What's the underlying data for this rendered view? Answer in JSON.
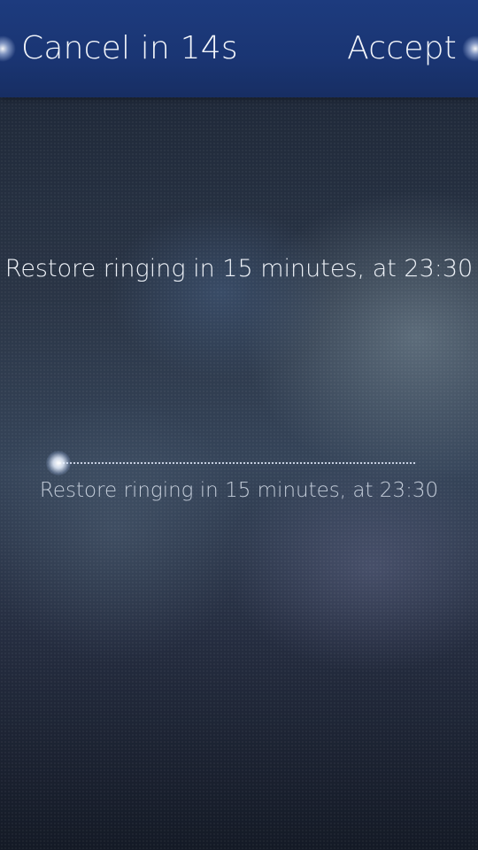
{
  "header": {
    "cancel_label": "Cancel in 14s",
    "accept_label": "Accept",
    "accent_color": "#1d3b7e"
  },
  "main": {
    "title": "Restore ringing in 15 minutes, at 23:30"
  },
  "slider": {
    "label": "Restore ringing in 15 minutes, at 23:30",
    "value": 0
  }
}
